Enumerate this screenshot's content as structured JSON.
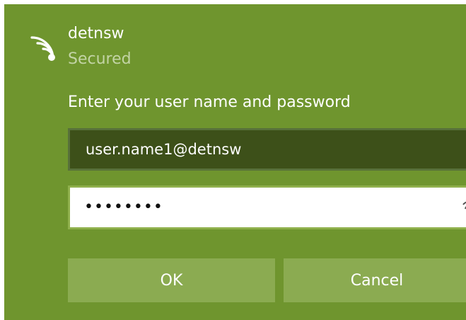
{
  "network": {
    "icon": "wifi-secured-icon",
    "name": "detnsw",
    "status": "Secured"
  },
  "auth": {
    "prompt": "Enter your user name and password",
    "username_value": "user.name1@detnsw",
    "password_masked": "••••••••",
    "password_length": 8
  },
  "buttons": {
    "ok_label": "OK",
    "cancel_label": "Cancel"
  },
  "colors": {
    "accent": "#6f952e",
    "button": "#8bab51",
    "username_field": "#3d5019",
    "status_text": "#c3d4a6"
  }
}
